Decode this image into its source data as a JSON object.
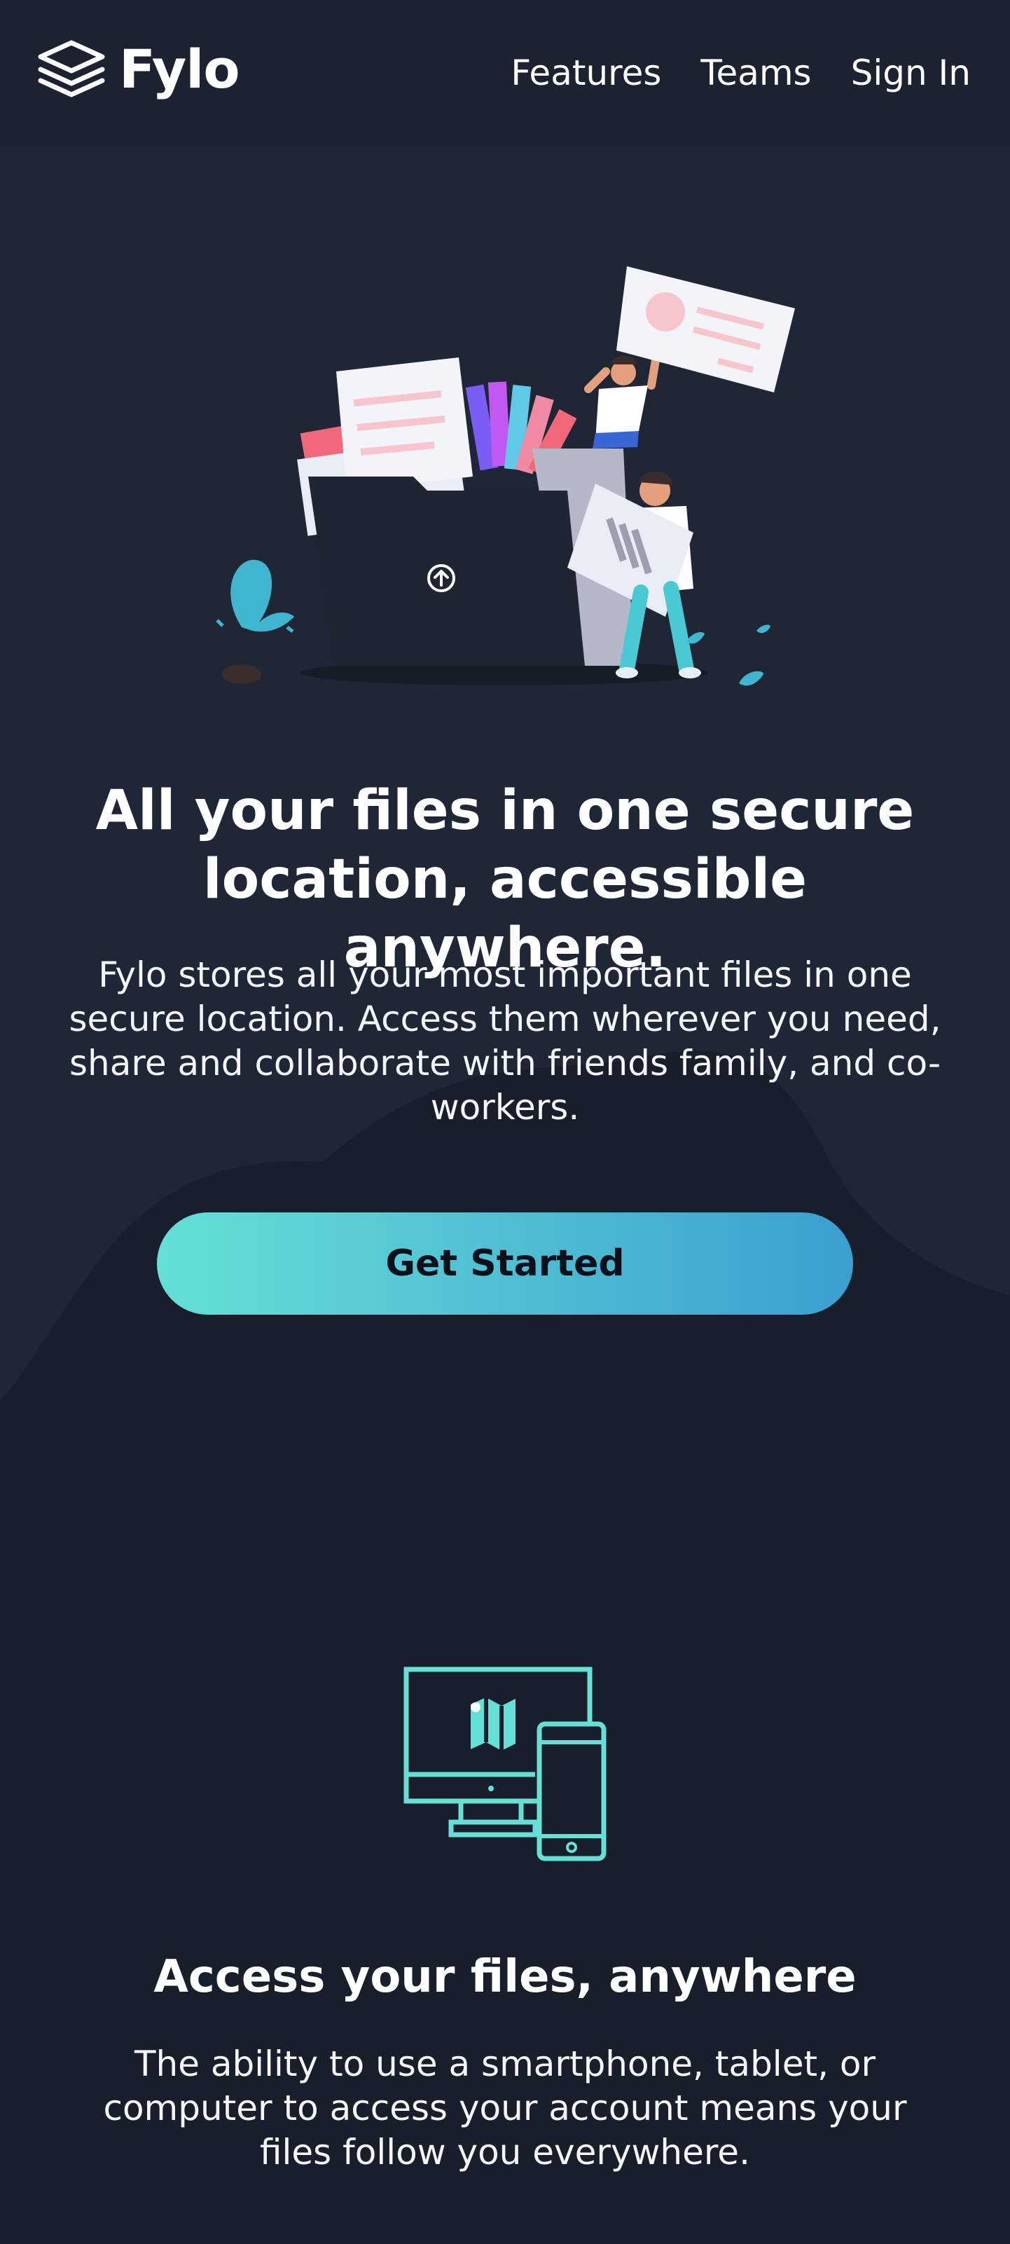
{
  "brand": {
    "name": "Fylo"
  },
  "nav": {
    "items": [
      "Features",
      "Teams",
      "Sign In"
    ]
  },
  "hero": {
    "title": "All your files in one secure location, accessible anywhere.",
    "description": "Fylo stores all your most important files in one secure location. Access them wherever you need, share and collaborate with friends family, and co-workers.",
    "cta_label": "Get Started"
  },
  "feature": {
    "icon": "devices-icon",
    "title": "Access your files, anywhere",
    "description": "The ability to use a smartphone, tablet, or computer to access your account means your files follow you everywhere."
  },
  "colors": {
    "page_bg": "#181f2a",
    "header_bg": "#1c2230",
    "hero_curve": "#1f2635",
    "accent_cyan": "#64e0d6",
    "accent_blue": "#3a9fd0"
  }
}
